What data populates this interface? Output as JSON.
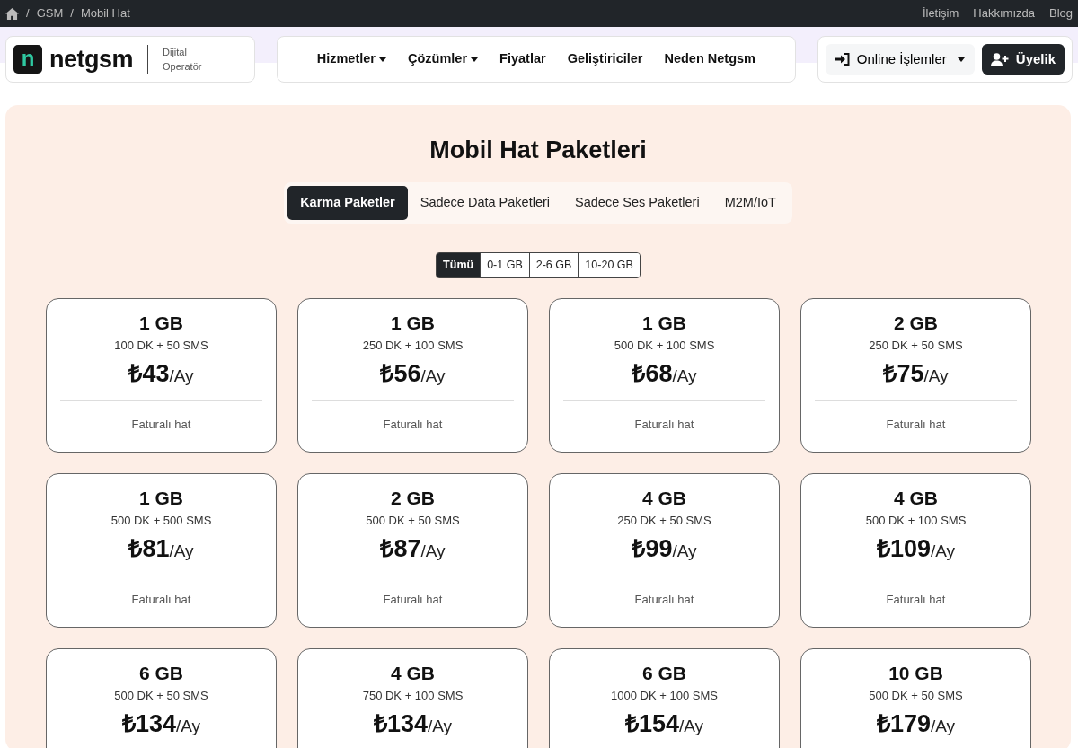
{
  "breadcrumb_separator": "/",
  "breadcrumb": [
    "GSM",
    "Mobil Hat"
  ],
  "top_links": [
    "İletişim",
    "Hakkımızda",
    "Blog"
  ],
  "logo": {
    "mark": "n",
    "name": "netgsm",
    "tagline_1": "Dijital",
    "tagline_2": "Operatör"
  },
  "nav": [
    {
      "label": "Hizmetler",
      "dropdown": true
    },
    {
      "label": "Çözümler",
      "dropdown": true
    },
    {
      "label": "Fiyatlar",
      "dropdown": false
    },
    {
      "label": "Geliştiriciler",
      "dropdown": false
    },
    {
      "label": "Neden Netgsm",
      "dropdown": false
    }
  ],
  "online_button": "Online İşlemler",
  "signup_button": "Üyelik",
  "title": "Mobil Hat Paketleri",
  "tabs": [
    {
      "label": "Karma Paketler",
      "selected": true
    },
    {
      "label": "Sadece Data Paketleri",
      "selected": false
    },
    {
      "label": "Sadece Ses Paketleri",
      "selected": false
    },
    {
      "label": "M2M/IoT",
      "selected": false
    }
  ],
  "filters": [
    {
      "label": "Tümü",
      "selected": true
    },
    {
      "label": "0-1 GB",
      "selected": false
    },
    {
      "label": "2-6 GB",
      "selected": false
    },
    {
      "label": "10-20 GB",
      "selected": false
    }
  ],
  "packages": [
    {
      "data": "1 GB",
      "details": "100 DK + 50 SMS",
      "price": "₺43",
      "period": "/Ay",
      "type": "Faturalı hat"
    },
    {
      "data": "1 GB",
      "details": "250 DK + 100 SMS",
      "price": "₺56",
      "period": "/Ay",
      "type": "Faturalı hat"
    },
    {
      "data": "1 GB",
      "details": "500 DK + 100 SMS",
      "price": "₺68",
      "period": "/Ay",
      "type": "Faturalı hat"
    },
    {
      "data": "2 GB",
      "details": "250 DK + 50 SMS",
      "price": "₺75",
      "period": "/Ay",
      "type": "Faturalı hat"
    },
    {
      "data": "1 GB",
      "details": "500 DK + 500 SMS",
      "price": "₺81",
      "period": "/Ay",
      "type": "Faturalı hat"
    },
    {
      "data": "2 GB",
      "details": "500 DK + 50 SMS",
      "price": "₺87",
      "period": "/Ay",
      "type": "Faturalı hat"
    },
    {
      "data": "4 GB",
      "details": "250 DK + 50 SMS",
      "price": "₺99",
      "period": "/Ay",
      "type": "Faturalı hat"
    },
    {
      "data": "4 GB",
      "details": "500 DK + 100 SMS",
      "price": "₺109",
      "period": "/Ay",
      "type": "Faturalı hat"
    },
    {
      "data": "6 GB",
      "details": "500 DK + 50 SMS",
      "price": "₺134",
      "period": "/Ay"
    },
    {
      "data": "4 GB",
      "details": "750 DK + 100 SMS",
      "price": "₺134",
      "period": "/Ay"
    },
    {
      "data": "6 GB",
      "details": "1000 DK + 100 SMS",
      "price": "₺154",
      "period": "/Ay"
    },
    {
      "data": "10 GB",
      "details": "500 DK + 50 SMS",
      "price": "₺179",
      "period": "/Ay"
    }
  ]
}
